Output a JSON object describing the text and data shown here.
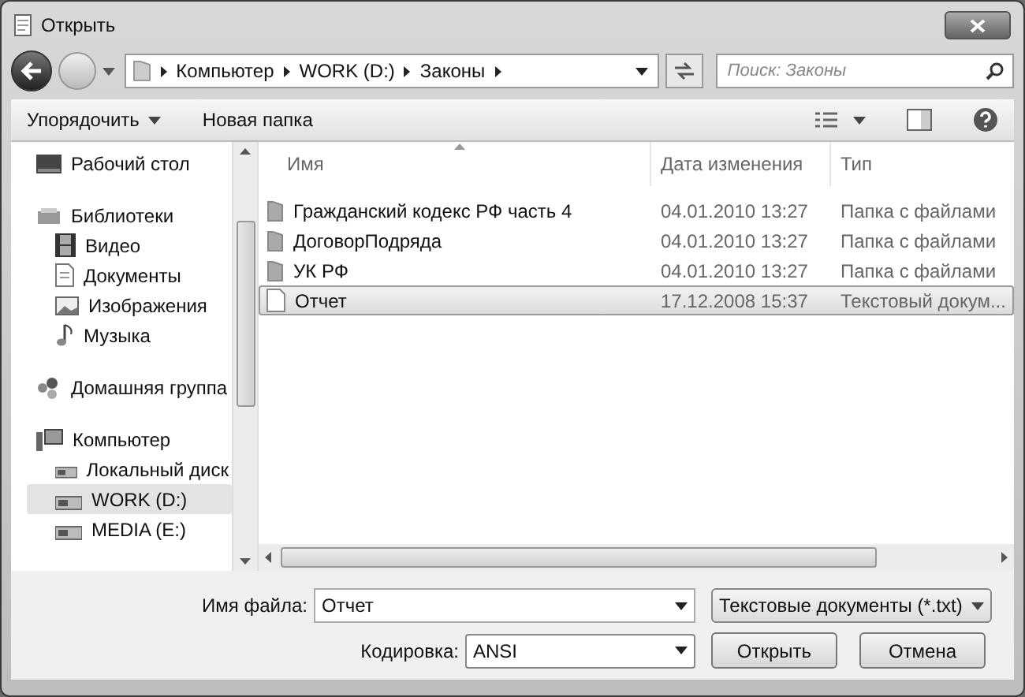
{
  "window": {
    "title": "Открыть"
  },
  "address": {
    "crumbs": [
      "Компьютер",
      "WORK (D:)",
      "Законы"
    ]
  },
  "search": {
    "placeholder": "Поиск: Законы"
  },
  "toolbar": {
    "buttons": [
      {
        "label": "Упорядочить",
        "dropdown": true
      },
      {
        "label": "Новая папка",
        "dropdown": false
      }
    ]
  },
  "sidebar": {
    "items": [
      {
        "label": "Рабочий стол",
        "kind": "desktop",
        "selected": false
      },
      {
        "label": "Библиотеки",
        "kind": "library",
        "selected": false,
        "children": [
          {
            "label": "Видео",
            "kind": "video",
            "selected": false
          },
          {
            "label": "Документы",
            "kind": "document",
            "selected": false
          },
          {
            "label": "Изображения",
            "kind": "image",
            "selected": false
          },
          {
            "label": "Музыка",
            "kind": "music",
            "selected": false
          }
        ]
      },
      {
        "label": "Домашняя группа",
        "kind": "homegroup",
        "selected": false
      },
      {
        "label": "Компьютер",
        "kind": "computer",
        "selected": false,
        "children": [
          {
            "label": "Локальный диск",
            "kind": "drive",
            "selected": false
          },
          {
            "label": "WORK (D:)",
            "kind": "drive",
            "selected": true
          },
          {
            "label": "MEDIA (E:)",
            "kind": "drive",
            "selected": false
          }
        ]
      }
    ]
  },
  "table": {
    "columns": [
      "Имя",
      "Дата изменения",
      "Тип"
    ],
    "rows": [
      {
        "name": "Гражданский кодекс РФ часть 4",
        "date": "04.01.2010 13:27",
        "type": "Папка с файлами",
        "kind": "folder",
        "selected": false
      },
      {
        "name": "ДоговорПодряда",
        "date": "04.01.2010 13:27",
        "type": "Папка с файлами",
        "kind": "folder",
        "selected": false
      },
      {
        "name": "УК РФ",
        "date": "04.01.2010 13:27",
        "type": "Папка с файлами",
        "kind": "folder",
        "selected": false
      },
      {
        "name": "Отчет",
        "date": "17.12.2008 15:37",
        "type": "Текстовый докум...",
        "kind": "file",
        "selected": true
      }
    ]
  },
  "filename": {
    "label": "Имя файла:",
    "value": "Отчет"
  },
  "filetype": {
    "value": "Текстовые документы (*.txt)"
  },
  "encoding": {
    "label": "Кодировка:",
    "value": "ANSI"
  },
  "buttons": [
    "Открыть",
    "Отмена"
  ]
}
